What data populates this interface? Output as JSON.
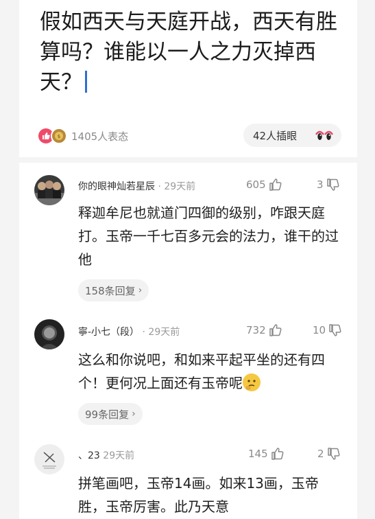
{
  "question": {
    "title": "假如西天与天庭开战，西天有胜算吗？谁能以一人之力灭掉西天？"
  },
  "reactions": {
    "count_text": "1405人表态",
    "insert_label": "42人插眼"
  },
  "comments": [
    {
      "user": "你的眼神灿若星辰",
      "time": "· 29天前",
      "likes": "605",
      "replies_count": "3",
      "body": "释迦牟尼也就道门四御的级别，咋跟天庭打。玉帝一千七百多元会的法力，谁干的过他",
      "reply_label": "158条回复"
    },
    {
      "user": "寧-小七（段）",
      "time": "· 29天前",
      "likes": "732",
      "replies_count": "10",
      "body": "这么和你说吧，和如来平起平坐的还有四个！更何况上面还有玉帝呢",
      "reply_label": "99条回复"
    },
    {
      "user": "、23",
      "time": "29天前",
      "likes": "145",
      "replies_count": "2",
      "body": "拼笔画吧，玉帝14画。如来13画，玉帝胜，玉帝厉害。此乃天意"
    }
  ],
  "colors": {
    "accent_cursor": "#2f6fd1",
    "like_reaction": "#f04a6a",
    "muted_text": "#8a8a8a"
  }
}
